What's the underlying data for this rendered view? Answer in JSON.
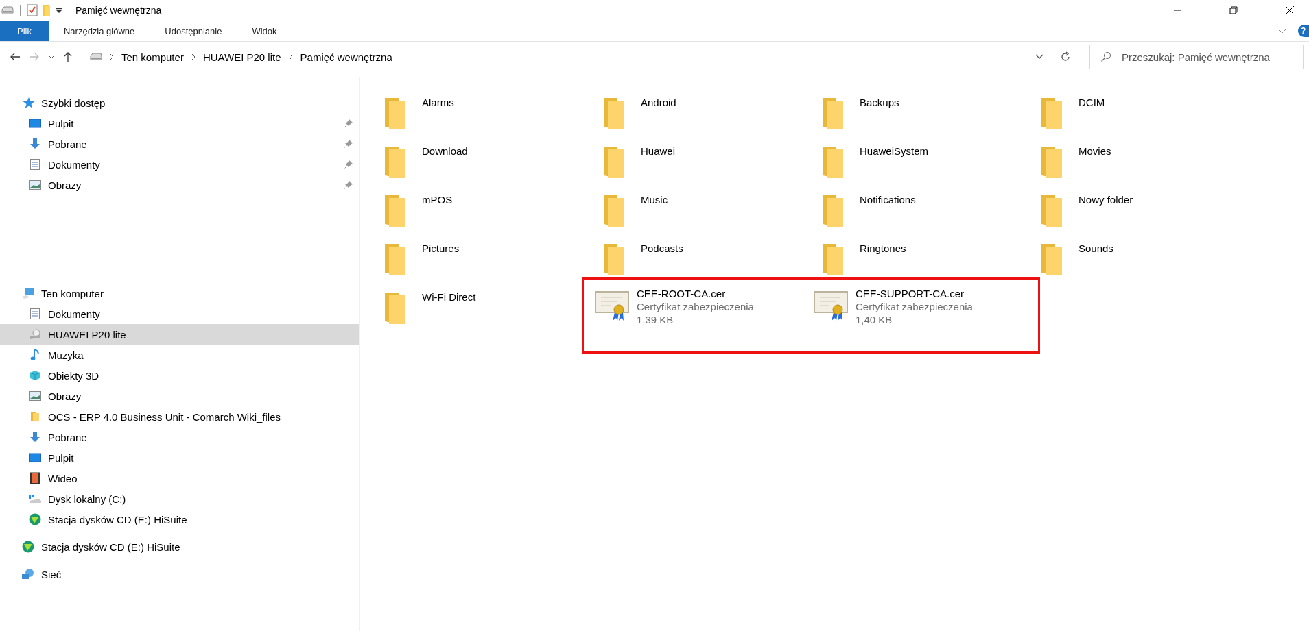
{
  "window": {
    "title": "Pamięć wewnętrzna"
  },
  "ribbon_tabs": [
    {
      "label": "Plik",
      "selected": true
    },
    {
      "label": "Narzędzia główne",
      "selected": false
    },
    {
      "label": "Udostępnianie",
      "selected": false
    },
    {
      "label": "Widok",
      "selected": false
    }
  ],
  "help_label": "?",
  "breadcrumbs": [
    "Ten komputer",
    "HUAWEI P20 lite",
    "Pamięć wewnętrzna"
  ],
  "search": {
    "placeholder": "Przeszukaj: Pamięć wewnętrzna"
  },
  "navigation": [
    {
      "label": "Szybki dostęp",
      "kind": "star",
      "selected": false,
      "children": [
        {
          "label": "Pulpit",
          "kind": "desktop",
          "pinned": true,
          "selected": false
        },
        {
          "label": "Pobrane",
          "kind": "download",
          "pinned": true,
          "selected": false
        },
        {
          "label": "Dokumenty",
          "kind": "document",
          "pinned": true,
          "selected": false
        },
        {
          "label": "Obrazy",
          "kind": "picture",
          "pinned": true,
          "selected": false
        }
      ]
    },
    {
      "label": "Ten komputer",
      "kind": "computer",
      "selected": false,
      "children": [
        {
          "label": "Dokumenty",
          "kind": "document",
          "pinned": false,
          "selected": false
        },
        {
          "label": "HUAWEI P20 lite",
          "kind": "phone",
          "pinned": false,
          "selected": true
        },
        {
          "label": "Muzyka",
          "kind": "music",
          "pinned": false,
          "selected": false
        },
        {
          "label": "Obiekty 3D",
          "kind": "cube",
          "pinned": false,
          "selected": false
        },
        {
          "label": "Obrazy",
          "kind": "picture",
          "pinned": false,
          "selected": false
        },
        {
          "label": "OCS - ERP 4.0 Business Unit - Comarch Wiki_files",
          "kind": "folder",
          "pinned": false,
          "selected": false
        },
        {
          "label": "Pobrane",
          "kind": "download",
          "pinned": false,
          "selected": false
        },
        {
          "label": "Pulpit",
          "kind": "desktop",
          "pinned": false,
          "selected": false
        },
        {
          "label": "Wideo",
          "kind": "video",
          "pinned": false,
          "selected": false
        },
        {
          "label": "Dysk lokalny (C:)",
          "kind": "drive",
          "pinned": false,
          "selected": false
        },
        {
          "label": "Stacja dysków CD (E:) HiSuite",
          "kind": "disc",
          "pinned": false,
          "selected": false
        }
      ]
    },
    {
      "label": "Stacja dysków CD (E:) HiSuite",
      "kind": "disc",
      "selected": false
    },
    {
      "label": "Sieć",
      "kind": "network",
      "selected": false
    }
  ],
  "folders": [
    {
      "name": "Alarms"
    },
    {
      "name": "Android"
    },
    {
      "name": "Backups"
    },
    {
      "name": "DCIM"
    },
    {
      "name": "Download"
    },
    {
      "name": "Huawei"
    },
    {
      "name": "HuaweiSystem"
    },
    {
      "name": "Movies"
    },
    {
      "name": "mPOS"
    },
    {
      "name": "Music"
    },
    {
      "name": "Notifications"
    },
    {
      "name": "Nowy folder"
    },
    {
      "name": "Pictures"
    },
    {
      "name": "Podcasts"
    },
    {
      "name": "Ringtones"
    },
    {
      "name": "Sounds"
    },
    {
      "name": "Wi-Fi Direct"
    }
  ],
  "highlighted_files": [
    {
      "name": "CEE-ROOT-CA.cer",
      "type": "Certyfikat zabezpieczenia",
      "size": "1,39 KB"
    },
    {
      "name": "CEE-SUPPORT-CA.cer",
      "type": "Certyfikat zabezpieczenia",
      "size": "1,40 KB"
    }
  ]
}
